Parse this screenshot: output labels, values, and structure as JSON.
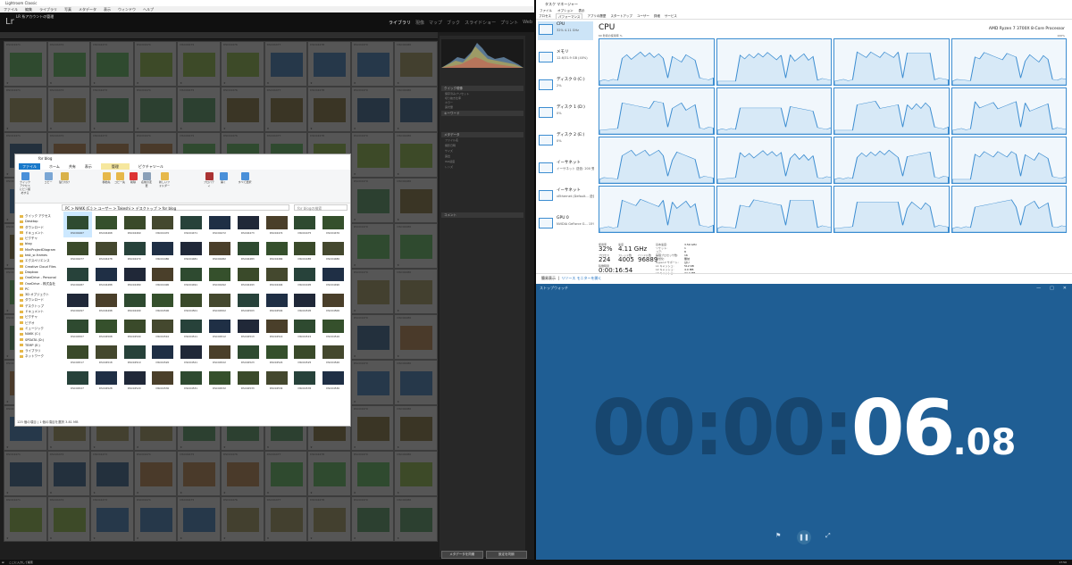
{
  "lightroom": {
    "title": "Lightroom Classic",
    "menu": [
      "ファイル",
      "編集",
      "ライブラリ",
      "写真",
      "メタデータ",
      "表示",
      "ウィンドウ",
      "ヘルプ"
    ],
    "catalog": "LR 系アカウントの管理",
    "logo": "Lr",
    "modules": [
      "ライブラリ",
      "現像",
      "マップ",
      "ブック",
      "スライドショー",
      "プリント",
      "Web"
    ],
    "active_module": "ライブラリ",
    "panel_headers": [
      "ヒストグラム",
      "クイック現像",
      "キーワード",
      "メタデータ",
      "コメント"
    ],
    "panel_labels": [
      "保存済みプリセット",
      "切り抜き比率",
      "カラー",
      "露光量",
      "ファイル名",
      "撮影日時",
      "サイズ",
      "露出",
      "ISO感度",
      "レンズ"
    ],
    "buttons": [
      "メタデータを同期",
      "設定を同期"
    ],
    "cell_numbers": [
      "DSC04471",
      "DSC04472",
      "DSC04473",
      "DSC04474",
      "DSC04475",
      "DSC04476",
      "DSC04477",
      "DSC04478",
      "DSC04479",
      "DSC04480"
    ]
  },
  "explorer": {
    "title": "for blog",
    "tabs": [
      "ファイル",
      "ホーム",
      "共有",
      "表示",
      "ピクチャツール"
    ],
    "manage_tab": "管理",
    "ribbon": [
      "クイックアクセスにピン留めする",
      "コピー",
      "貼り付け",
      "移動先",
      "コピー先",
      "削除",
      "名前の変更",
      "新しいフォルダー",
      "プロパティ",
      "開く",
      "すべて選択",
      "選択解除",
      "選択の切り替え"
    ],
    "path": "PC > NAKK (C:) > ユーザー > Takeshi > デスクトップ > for blog",
    "search_placeholder": "for blogの検索",
    "nav": [
      "クイック アクセス",
      "Desktop",
      "ダウンロード",
      "ドキュメント",
      "ピクチャ",
      "blog",
      "MiniProjectDiagram",
      "test_sr-frames",
      "エクスペリエンス",
      "Creative Cloud Files",
      "Dropbox",
      "OneDrive - Personal",
      "OneDrive - 株式会社",
      "PC",
      "3D オブジェクト",
      "ダウンロード",
      "デスクトップ",
      "ドキュメント",
      "ピクチャ",
      "ビデオ",
      "ミュージック",
      "NAKK (C:)",
      "SPDATA (D:)",
      "TEMP (E:)",
      "ライブラリ",
      "ネットワーク"
    ],
    "files": [
      "DSC04467",
      "DSC04468",
      "DSC04469",
      "DSC04470",
      "DSC04471",
      "DSC04472",
      "DSC04473",
      "DSC04474",
      "DSC04475",
      "DSC04476",
      "DSC04477",
      "DSC04478",
      "DSC04479",
      "DSC04480",
      "DSC04481",
      "DSC04482",
      "DSC04483",
      "DSC04484",
      "DSC04485",
      "DSC04486",
      "DSC04487",
      "DSC04488",
      "DSC04489",
      "DSC04490",
      "DSC04491",
      "DSC04492",
      "DSC04493",
      "DSC04494",
      "DSC04495",
      "DSC04496",
      "DSC04497",
      "DSC04498",
      "DSC04499",
      "DSC04500",
      "DSC04501",
      "DSC04502",
      "DSC04503",
      "DSC04504",
      "DSC04505",
      "DSC04506",
      "DSC04507",
      "DSC04508",
      "DSC04509",
      "DSC04510",
      "DSC04511",
      "DSC04512",
      "DSC04513",
      "DSC04514",
      "DSC04515",
      "DSC04516",
      "DSC04517",
      "DSC04518",
      "DSC04519",
      "DSC04520",
      "DSC04521",
      "DSC04522",
      "DSC04523",
      "DSC04524",
      "DSC04525",
      "DSC04526",
      "DSC04527",
      "DSC04528",
      "DSC04529",
      "DSC04530",
      "DSC04531",
      "DSC04532",
      "DSC04533",
      "DSC04534",
      "DSC04535",
      "DSC04536"
    ],
    "status": "125 個の項目 | 1 個の項目を選択 3.81 MB"
  },
  "taskmgr": {
    "title": "タスク マネージャー",
    "menu": [
      "ファイル",
      "オプション",
      "表示"
    ],
    "tabs": [
      "プロセス",
      "パフォーマンス",
      "アプリの履歴",
      "スタートアップ",
      "ユーザー",
      "詳細",
      "サービス"
    ],
    "active_tab": "パフォーマンス",
    "sidebar": [
      {
        "name": "CPU",
        "detail": "32%  4.11 GHz"
      },
      {
        "name": "メモリ",
        "detail": "12.6/31.9 GB (40%)"
      },
      {
        "name": "ディスク 0 (C:)",
        "detail": "2%"
      },
      {
        "name": "ディスク 1 (D:)",
        "detail": "0%"
      },
      {
        "name": "ディスク 2 (E:)",
        "detail": "0%"
      },
      {
        "name": "イーサネット",
        "detail": "イーサネット  送信: 200  受信: 256 Kbp"
      },
      {
        "name": "イーサネット",
        "detail": "vEthernet (Default...  送信: 0  受信: 0 Kbps"
      },
      {
        "name": "GPU 0",
        "detail": "NVIDIA GeForce G...  15%"
      }
    ],
    "heading": "CPU",
    "cpu_name": "AMD Ryzen 7 3700X 8-Core Processor",
    "util_label": "60 秒間の使用率 %",
    "max_label": "100%",
    "stats": [
      {
        "label": "使用率",
        "value": "32%"
      },
      {
        "label": "速度",
        "value": "4.11 GHz"
      },
      {
        "label": "プロセス",
        "value": "224"
      },
      {
        "label": "スレッド数",
        "value": "4005"
      },
      {
        "label": "ハンドル数",
        "value": "96889"
      },
      {
        "label": "稼働時間",
        "value": "0:00:16:54"
      }
    ],
    "specs": [
      {
        "label": "基本速度:",
        "value": "3.59 GHz"
      },
      {
        "label": "ソケット:",
        "value": "1"
      },
      {
        "label": "コア:",
        "value": "8"
      },
      {
        "label": "論理プロセッサ数:",
        "value": "16"
      },
      {
        "label": "仮想化:",
        "value": "無効"
      },
      {
        "label": "Hyper-V サポート:",
        "value": "はい"
      },
      {
        "label": "L1 キャッシュ:",
        "value": "512 KB"
      },
      {
        "label": "L2 キャッシュ:",
        "value": "4.0 MB"
      },
      {
        "label": "L3 キャッシュ:",
        "value": "32.0 MB"
      }
    ],
    "footer_brief": "簡易表示",
    "footer_link": "リソース モニターを開く"
  },
  "stopwatch": {
    "title": "ストップウォッチ",
    "time_dim": "00:00:",
    "time_bright": "06",
    "time_frac": ".08"
  },
  "taskbar": {
    "search": "ここに入力して検索",
    "clock": "17:50"
  }
}
